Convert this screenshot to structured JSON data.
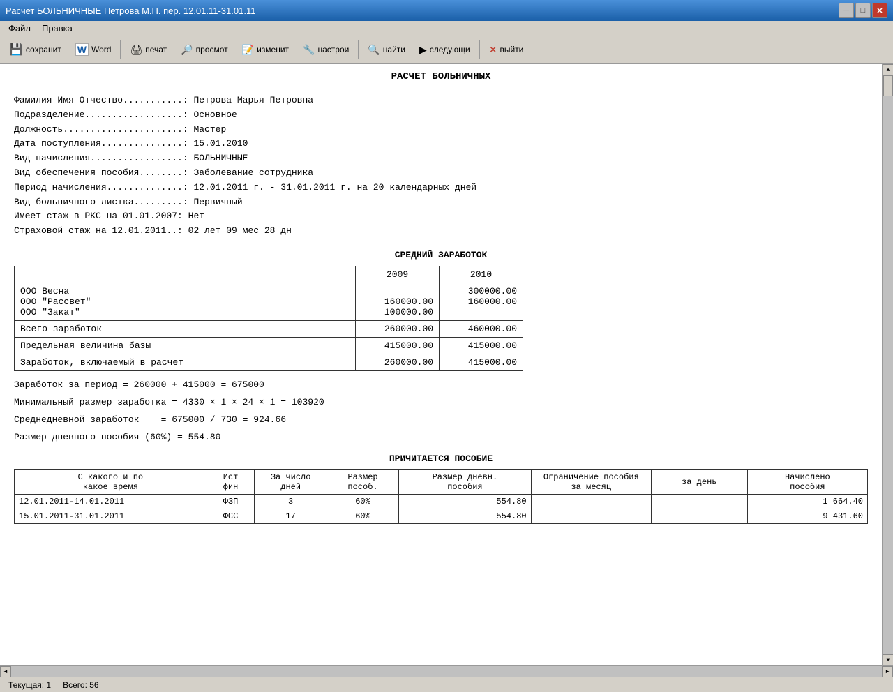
{
  "titleBar": {
    "title": "Расчет БОЛЬНИЧНЫЕ Петрова М.П. пер. 12.01.11-31.01.11",
    "minBtn": "─",
    "maxBtn": "□",
    "closeBtn": "✕"
  },
  "menuBar": {
    "items": [
      "Файл",
      "Правка"
    ]
  },
  "toolbar": {
    "buttons": [
      {
        "id": "save",
        "icon": "💾",
        "label": "сохранит"
      },
      {
        "id": "word",
        "icon": "W",
        "label": "Word"
      },
      {
        "id": "print",
        "icon": "🖨",
        "label": "печат"
      },
      {
        "id": "view",
        "icon": "👁",
        "label": "просмот"
      },
      {
        "id": "edit",
        "icon": "✏",
        "label": "изменит"
      },
      {
        "id": "settings",
        "icon": "⚙",
        "label": "настрои"
      },
      {
        "id": "find",
        "icon": "🔍",
        "label": "найти"
      },
      {
        "id": "next",
        "icon": "▶",
        "label": "следующи"
      },
      {
        "id": "exit",
        "icon": "✕",
        "label": "выйти"
      }
    ]
  },
  "document": {
    "title": "РАСЧЕТ БОЛЬНИЧНЫХ",
    "fields": [
      {
        "label": "Фамилия Имя Отчество..........:",
        "value": "Петрова Марья Петровна"
      },
      {
        "label": "Подразделение.................:",
        "value": "Основное"
      },
      {
        "label": "Должность.....................:",
        "value": "Мастер"
      },
      {
        "label": "Дата поступления..............:",
        "value": "15.01.2010"
      },
      {
        "label": "Вид начисления................:",
        "value": "БОЛЬНИЧНЫЕ"
      },
      {
        "label": "Вид обеспечения пособия........:",
        "value": "Заболевание сотрудника"
      },
      {
        "label": "Период начисления.............:",
        "value": "12.01.2011 г. - 31.01.2011 г. на 20 календарных дней"
      },
      {
        "label": "Вид больничного листка........:",
        "value": "Первичный"
      },
      {
        "label": "Имеет стаж в РКС на 01.01.2007:",
        "value": "Нет"
      },
      {
        "label": "Страховой стаж на 12.01.2011..:",
        "value": "02 лет 09 мес 28 дн"
      }
    ],
    "avgEarningsTitle": "СРЕДНИЙ   ЗАРАБОТОК",
    "earningsTable": {
      "headers": [
        "",
        "2009",
        "2010"
      ],
      "rows": [
        {
          "desc": "ООО Весна\nООО \"Рассвет\"\nООО \"Закат\"",
          "y2009": "160000.00\n100000.00",
          "y2010": "300000.00\n160000.00"
        },
        {
          "desc": "Всего заработок",
          "y2009": "260000.00",
          "y2010": "460000.00"
        },
        {
          "desc": "Предельная величина базы",
          "y2009": "415000.00",
          "y2010": "415000.00"
        },
        {
          "desc": "Заработок, включаемый в расчет",
          "y2009": "260000.00",
          "y2010": "415000.00"
        }
      ]
    },
    "formulas": [
      "Заработок за период = 260000 + 415000 = 675000",
      "Минимальный размер заработка = 4330 × 1 × 24 × 1 = 103920",
      "Среднедневной заработок    = 675000 / 730 = 924.66",
      "Размер дневного пособия (60%) = 554.80"
    ],
    "benefitsTitle": "ПРИЧИТАЕТСЯ ПОСОБИЕ",
    "benefitsTable": {
      "headers": [
        "С какого и по\nкакое время",
        "Ист\nфин",
        "За число\nдней",
        "Размер\nпособ.",
        "Размер дневн.\nпособия",
        "Ограничение пособия\nза месяц    за день",
        "Начислено\nпособия"
      ],
      "rows": [
        {
          "period": "12.01.2011-14.01.2011",
          "source": "ФЗП",
          "days": "3",
          "pct": "60%",
          "daily": "554.80",
          "limitMonth": "",
          "limitDay": "",
          "accrued": "1 664.40"
        },
        {
          "period": "15.01.2011-31.01.2011",
          "source": "ФСС",
          "days": "17",
          "pct": "60%",
          "daily": "554.80",
          "limitMonth": "",
          "limitDay": "",
          "accrued": "9 431.60"
        }
      ]
    }
  },
  "statusBar": {
    "current": "Текущая: 1",
    "total": "Всего: 56"
  }
}
